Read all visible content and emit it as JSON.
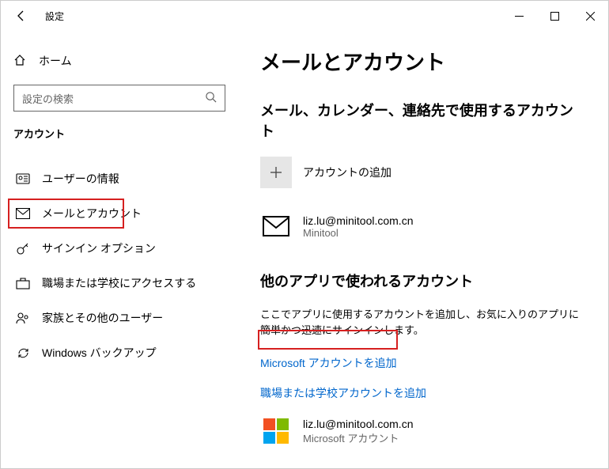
{
  "window": {
    "title": "設定"
  },
  "sidebar": {
    "home": "ホーム",
    "search_placeholder": "設定の検索",
    "section": "アカウント",
    "items": [
      {
        "label": "ユーザーの情報"
      },
      {
        "label": "メールとアカウント"
      },
      {
        "label": "サインイン オプション"
      },
      {
        "label": "職場または学校にアクセスする"
      },
      {
        "label": "家族とその他のユーザー"
      },
      {
        "label": "Windows バックアップ"
      }
    ]
  },
  "main": {
    "title": "メールとアカウント",
    "section1_head": "メール、カレンダー、連絡先で使用するアカウント",
    "add_account": "アカウントの追加",
    "account1": {
      "email": "liz.lu@minitool.com.cn",
      "name": "Minitool"
    },
    "section2_head": "他のアプリで使われるアカウント",
    "section2_body": "ここでアプリに使用するアカウントを追加し、お気に入りのアプリに簡単かつ迅速にサインインします。",
    "link_add_ms": "Microsoft アカウントを追加",
    "link_add_work": "職場または学校アカウントを追加",
    "account2": {
      "email": "liz.lu@minitool.com.cn",
      "name": "Microsoft アカウント"
    }
  }
}
